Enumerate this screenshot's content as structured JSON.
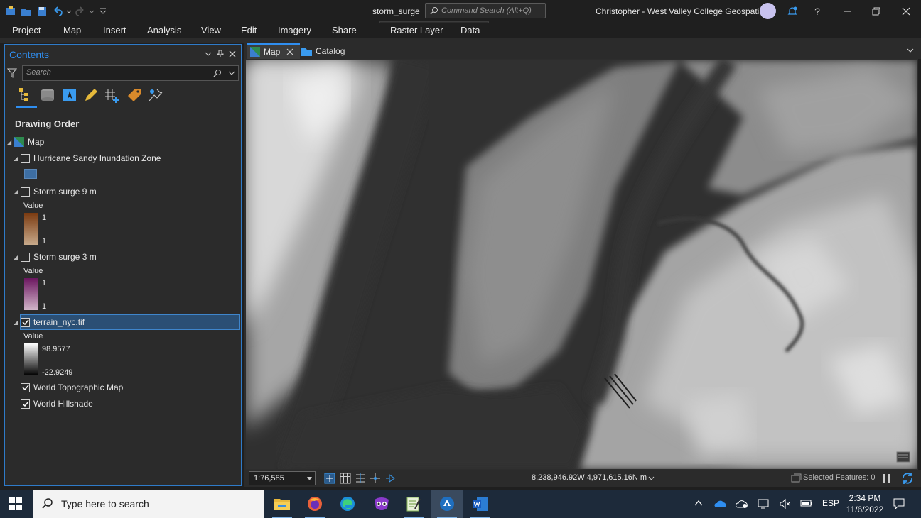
{
  "app": {
    "document_title": "storm_surge",
    "command_search_placeholder": "Command Search (Alt+Q)",
    "user": "Christopher  -  West Valley College Geospatial"
  },
  "ribbon": {
    "tabs": [
      "Project",
      "Map",
      "Insert",
      "Analysis",
      "View",
      "Edit",
      "Imagery",
      "Share"
    ],
    "contextual_tabs": [
      "Raster Layer",
      "Data"
    ]
  },
  "contents": {
    "title": "Contents",
    "search_placeholder": "Search",
    "section": "Drawing Order",
    "map_node": "Map",
    "layers": [
      {
        "name": "Hurricane Sandy Inundation Zone",
        "checked": false,
        "swatch_color": "#3d6ea3"
      },
      {
        "name": "Storm surge 9 m",
        "checked": false,
        "value_label": "Value",
        "ramp_max": "1",
        "ramp_min": "1",
        "ramp_colors": [
          "#7a3a10",
          "#c7a98a"
        ]
      },
      {
        "name": "Storm surge 3 m",
        "checked": false,
        "value_label": "Value",
        "ramp_max": "1",
        "ramp_min": "1",
        "ramp_colors": [
          "#6c1660",
          "#d1b6c9"
        ]
      },
      {
        "name": "terrain_nyc.tif",
        "checked": true,
        "selected": true,
        "value_label": "Value",
        "ramp_max": "98.9577",
        "ramp_min": "-22.9249",
        "ramp_colors": [
          "#ffffff",
          "#000000"
        ]
      },
      {
        "name": "World Topographic Map",
        "checked": true
      },
      {
        "name": "World Hillshade",
        "checked": true
      }
    ]
  },
  "map_view": {
    "tabs": [
      "Map",
      "Catalog"
    ],
    "scale": "1:76,585",
    "coordinates": "8,238,946.92W 4,971,615.16N m",
    "selected_features": "Selected Features: 0"
  },
  "taskbar": {
    "search_placeholder": "Type here to search",
    "language": "ESP",
    "time": "2:34 PM",
    "date": "11/6/2022"
  },
  "colors": {
    "accent": "#2f8ef0",
    "selection": "#2b4f74",
    "pane_background": "#2b2b2b",
    "titlebar_background": "#1f1f1f"
  }
}
